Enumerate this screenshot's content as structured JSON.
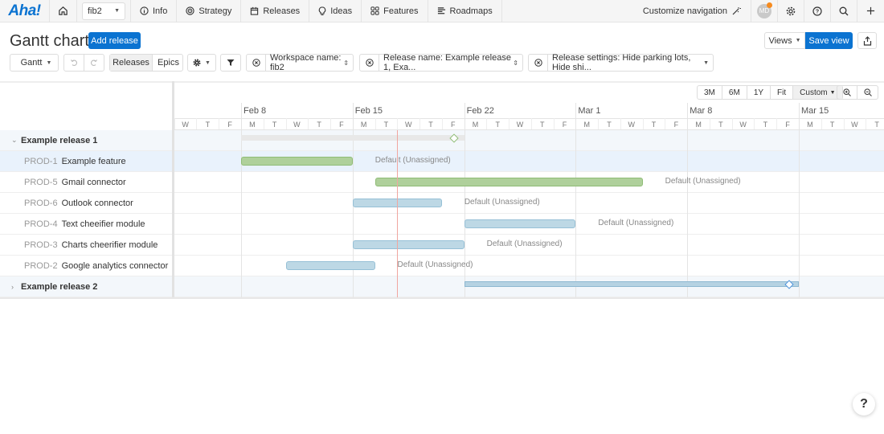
{
  "nav": {
    "logo": "Aha!",
    "workspace": "fib2",
    "items": [
      {
        "label": "Info",
        "icon": "info-icon"
      },
      {
        "label": "Strategy",
        "icon": "target-icon"
      },
      {
        "label": "Releases",
        "icon": "calendar-icon"
      },
      {
        "label": "Ideas",
        "icon": "lightbulb-icon"
      },
      {
        "label": "Features",
        "icon": "grid-icon"
      },
      {
        "label": "Roadmaps",
        "icon": "roadmap-icon"
      }
    ],
    "customize": "Customize navigation",
    "avatar_initials": "MD"
  },
  "page": {
    "title": "Gantt chart",
    "add_release": "Add release",
    "views": "Views",
    "save_view": "Save view"
  },
  "toolbar": {
    "view_type": "Gantt",
    "releases": "Releases",
    "epics": "Epics",
    "filters": [
      "Workspace name: fib2",
      "Release name: Example release 1, Exa...",
      "Release settings: Hide parking lots, Hide shi..."
    ]
  },
  "range": {
    "options": [
      "3M",
      "6M",
      "1Y",
      "Fit",
      "Custom"
    ]
  },
  "timeline": {
    "weeks": [
      "Feb 8",
      "Feb 15",
      "Feb 22",
      "Mar 1",
      "Mar 8",
      "Mar 15"
    ],
    "leading_days": [
      "W",
      "T",
      "F"
    ],
    "week_days": [
      "M",
      "T",
      "W",
      "T",
      "F"
    ],
    "trailing_days": [
      "M",
      "T",
      "W",
      "T"
    ],
    "today_offset_days": 7.0
  },
  "rows": [
    {
      "type": "release",
      "name": "Example release 1",
      "expanded": true,
      "bar": {
        "start": 0,
        "end": 10,
        "style": "rel-gray"
      },
      "milestone": 9.55
    },
    {
      "type": "feature",
      "ref": "PROD-1",
      "name": "Example feature",
      "selected": true,
      "bar": {
        "start": 0,
        "end": 5,
        "style": "green"
      },
      "label": "Default (Unassigned)"
    },
    {
      "type": "feature",
      "ref": "PROD-5",
      "name": "Gmail connector",
      "bar": {
        "start": 6,
        "end": 18,
        "style": "green"
      },
      "label": "Default (Unassigned)"
    },
    {
      "type": "feature",
      "ref": "PROD-6",
      "name": "Outlook connector",
      "bar": {
        "start": 5,
        "end": 9,
        "style": "blue"
      },
      "label": "Default (Unassigned)"
    },
    {
      "type": "feature",
      "ref": "PROD-4",
      "name": "Text cheeifier module",
      "bar": {
        "start": 10,
        "end": 15,
        "style": "blue"
      },
      "label": "Default (Unassigned)"
    },
    {
      "type": "feature",
      "ref": "PROD-3",
      "name": "Charts cheerifier module",
      "bar": {
        "start": 5,
        "end": 10,
        "style": "blue"
      },
      "label": "Default (Unassigned)"
    },
    {
      "type": "feature",
      "ref": "PROD-2",
      "name": "Google analytics connector",
      "bar": {
        "start": 2,
        "end": 6,
        "style": "blue"
      },
      "label": "Default (Unassigned)"
    },
    {
      "type": "release",
      "name": "Example release 2",
      "expanded": false,
      "bar": {
        "start": 10,
        "end": 25,
        "style": "rel-blue"
      },
      "milestone": 24.55
    }
  ],
  "help": "?"
}
